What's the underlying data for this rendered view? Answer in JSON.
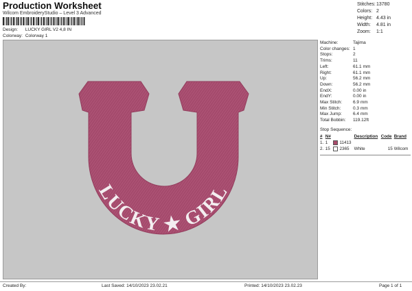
{
  "header": {
    "title": "Production Worksheet",
    "subtitle": "Wilcom EmbroideryStudio – Level 3 Advanced",
    "barcode_text": "‖"
  },
  "meta": [
    {
      "label": "Design:",
      "value": "LUCKY GIRL V2 4,8 IN"
    },
    {
      "label": "Colorway:",
      "value": "Colorway 1"
    }
  ],
  "summary": [
    {
      "label": "Stitches:",
      "value": "13780"
    },
    {
      "label": "Colors:",
      "value": "2"
    },
    {
      "label": "Height:",
      "value": "4.43 in"
    },
    {
      "label": "Width:",
      "value": "4.81 in"
    },
    {
      "label": "Zoom:",
      "value": "1:1"
    }
  ],
  "details": [
    {
      "label": "Machine:",
      "value": "Tajima"
    },
    {
      "label": "Color changes:",
      "value": "1"
    },
    {
      "label": "Stops:",
      "value": "2"
    },
    {
      "label": "Trims:",
      "value": "11"
    },
    {
      "label": "Left:",
      "value": "61.1 mm"
    },
    {
      "label": "Right:",
      "value": "61.1 mm"
    },
    {
      "label": "Up:",
      "value": "56.2 mm"
    },
    {
      "label": "Down:",
      "value": "56.2 mm"
    },
    {
      "label": "EndX:",
      "value": "0.00 in"
    },
    {
      "label": "EndY:",
      "value": "0.00 in"
    },
    {
      "label": "Max Stitch:",
      "value": "6.9 mm"
    },
    {
      "label": "Min Stitch:",
      "value": "0.3 mm"
    },
    {
      "label": "Max Jump:",
      "value": "6.4 mm"
    },
    {
      "label": "Total Bobbin:",
      "value": "119.12ft"
    }
  ],
  "stop_sequence": {
    "title": "Stop Sequence:",
    "columns": [
      "#",
      "N#",
      "Description",
      "Code",
      "Brand"
    ],
    "rows": [
      {
        "num": "1.",
        "n": "1",
        "color": "#a84b6b",
        "code_text": "11413",
        "description": "",
        "code": "",
        "brand": ""
      },
      {
        "num": "2.",
        "n": "15",
        "color": "#ffffff",
        "code_text": "2365",
        "description": "White",
        "code": "15",
        "brand": "Wilcom"
      }
    ]
  },
  "design": {
    "text_left": "LUCKY",
    "text_right": "GIRL",
    "star": "★",
    "fill_color": "#a44a6c",
    "text_color": "#ffffff"
  },
  "footer": {
    "created_by": "Created By:",
    "last_saved": "Last Saved: 14/10/2023 23.02.21",
    "printed": "Printed: 14/10/2023 23.02.23",
    "page": "Page 1 of 1"
  }
}
